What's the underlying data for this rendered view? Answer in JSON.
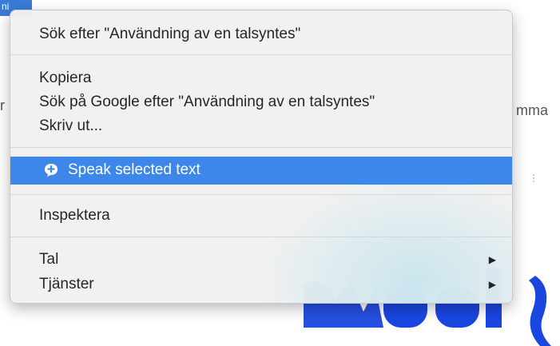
{
  "background": {
    "selection_text": "ni",
    "left_fragment": "r",
    "right_fragment": "mma"
  },
  "menu": {
    "search_item": "Sök efter \"Användning av en talsyntes\"",
    "copy_item": "Kopiera",
    "google_item": "Sök på Google efter \"Användning av en talsyntes\"",
    "print_item": "Skriv ut...",
    "speak_item": "Speak selected text",
    "inspect_item": "Inspektera",
    "speech_item": "Tal",
    "services_item": "Tjänster",
    "submenu_arrow": "▶",
    "highlight_color": "#3d87ea",
    "speak_icon": "speech-bubble-icon"
  }
}
